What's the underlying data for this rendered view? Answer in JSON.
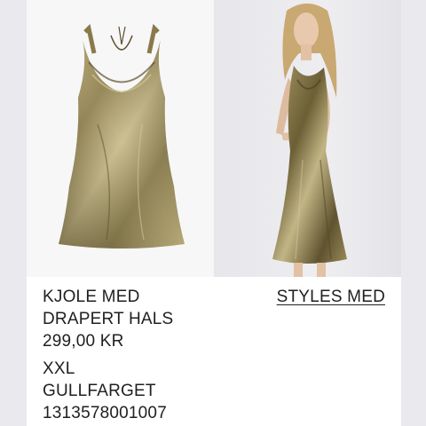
{
  "product": {
    "name_line1": "KJOLE MED",
    "name_line2": "DRAPERT HALS",
    "price": "299,00 KR",
    "size": "XXL",
    "color_name": "GULLFARGET",
    "article_number": "1313578001007"
  },
  "links": {
    "styles_with": "STYLES MED"
  },
  "colors": {
    "background_sidebar": "#e9e9ee",
    "text": "#1f1f1f",
    "dress_gold": "#8a7a4a"
  }
}
